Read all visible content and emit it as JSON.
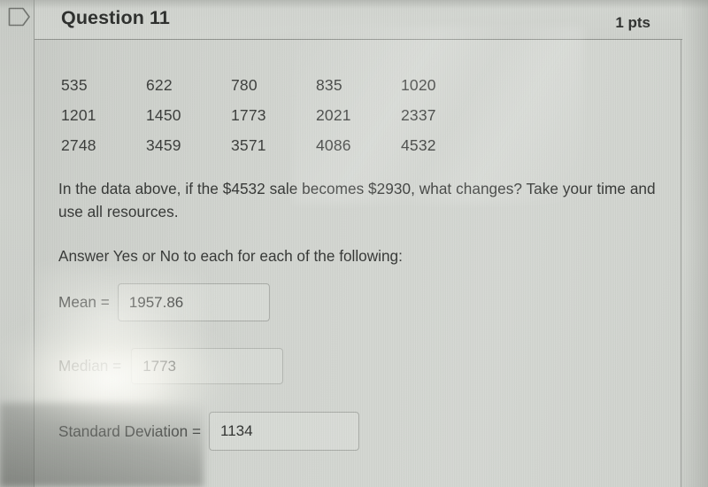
{
  "header": {
    "flag_icon": "flag-bookmark-icon",
    "title": "Question 11",
    "points": "1 pts"
  },
  "data_grid": {
    "rows": [
      [
        "535",
        "622",
        "780",
        "835",
        "1020"
      ],
      [
        "1201",
        "1450",
        "1773",
        "2021",
        "2337"
      ],
      [
        "2748",
        "3459",
        "3571",
        "4086",
        "4532"
      ]
    ]
  },
  "question": {
    "prompt": "In the data above, if the $4532 sale becomes $2930, what changes? Take your time and use all resources.",
    "instruction": "Answer Yes or No to each for each of the following:"
  },
  "answers": [
    {
      "label": "Mean =",
      "value": "1957.86"
    },
    {
      "label": "Median =",
      "value": "1773"
    },
    {
      "label": "Standard Deviation =",
      "value": "1134"
    }
  ],
  "colors": {
    "page_background": "#d2d5d0",
    "card_border": "#9b9e99",
    "text": "#343634",
    "input_border": "#a8aba6"
  }
}
